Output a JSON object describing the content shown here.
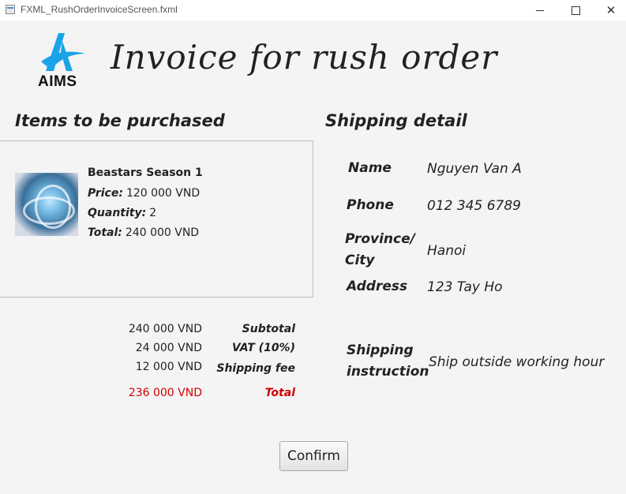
{
  "window": {
    "title": "FXML_RushOrderInvoiceScreen.fxml",
    "minimize_icon": "minimize-icon",
    "maximize_icon": "maximize-icon",
    "close_icon": "close-icon"
  },
  "header": {
    "logo_text": "AIMS",
    "title": "Invoice for rush order"
  },
  "items_section": {
    "title": "Items to be purchased",
    "items": [
      {
        "name": "Beastars Season 1",
        "price_label": "Price:",
        "price": "120 000 VND",
        "quantity_label": "Quantity:",
        "quantity": "2",
        "total_label": "Total:",
        "total": "240 000 VND"
      }
    ]
  },
  "summary": {
    "subtotal_value": "240 000 VND",
    "subtotal_label": "Subtotal",
    "vat_value": "24 000 VND",
    "vat_label": "VAT (10%)",
    "shipping_value": "12 000 VND",
    "shipping_label": "Shipping fee",
    "total_value": "236 000 VND",
    "total_label": "Total",
    "total_color": "#d40000"
  },
  "shipping": {
    "title": "Shipping detail",
    "name_label": "Name",
    "name": "Nguyen Van A",
    "phone_label": "Phone",
    "phone": "012 345 6789",
    "province_label_1": "Province/",
    "province_label_2": "City",
    "province": "Hanoi",
    "address_label": "Address",
    "address": "123 Tay Ho",
    "instruction_label_1": "Shipping",
    "instruction_label_2": "instruction",
    "instruction": "Ship outside working hour"
  },
  "actions": {
    "confirm_label": "Confirm"
  },
  "colors": {
    "logo_blue": "#1aa3e8",
    "background": "#f4f4f4"
  }
}
